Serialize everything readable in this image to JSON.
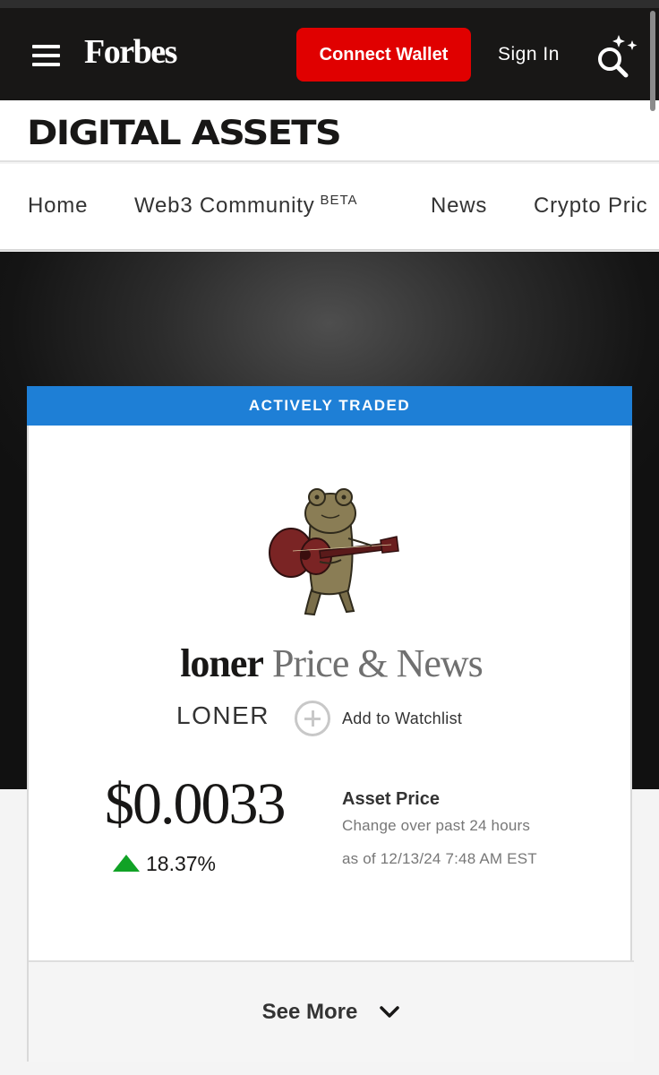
{
  "header": {
    "logo": "Forbes",
    "connect_wallet": "Connect Wallet",
    "sign_in": "Sign In",
    "colors": {
      "bar": "#181716",
      "connect": "#e00000"
    }
  },
  "section": {
    "title": "DIGITAL ASSETS"
  },
  "nav": {
    "items": [
      {
        "label": "Home"
      },
      {
        "label": "Web3 Community",
        "badge": "BETA"
      },
      {
        "label": "News"
      },
      {
        "label": "Crypto Pric"
      }
    ]
  },
  "asset": {
    "banner": "ACTIVELY TRADED",
    "banner_color": "#1e7fd6",
    "name": "loner",
    "title_suffix": "Price & News",
    "ticker": "LONER",
    "watchlist_label": "Add to Watchlist",
    "price": "$0.0033",
    "change": "18.37%",
    "change_direction": "up",
    "change_color": "#11a226",
    "price_label": "Asset Price",
    "change_label": "Change over past 24 hours",
    "as_of": "as of 12/13/24 7:48 AM EST",
    "see_more": "See More",
    "avatar_icon": "frog-with-guitar-icon"
  }
}
